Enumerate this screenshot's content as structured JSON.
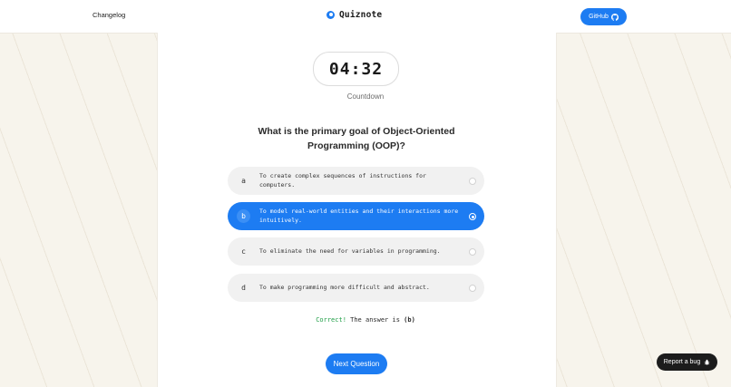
{
  "header": {
    "changelog_label": "Changelog",
    "brand_name": "Quiznote",
    "github_label": "GitHub"
  },
  "timer": {
    "value": "04:32",
    "label": "Countdown"
  },
  "question": {
    "text": "What is the primary goal of Object-Oriented Programming (OOP)?"
  },
  "options": [
    {
      "letter": "a",
      "text": "To create complex sequences of instructions for computers.",
      "selected": false
    },
    {
      "letter": "b",
      "text": "To model real-world entities and their interactions more intuitively.",
      "selected": true
    },
    {
      "letter": "c",
      "text": "To eliminate the need for variables in programming.",
      "selected": false
    },
    {
      "letter": "d",
      "text": "To make programming more difficult and abstract.",
      "selected": false
    }
  ],
  "result": {
    "status": "Correct!",
    "message": "The answer is",
    "answer": "(b)"
  },
  "next_button_label": "Next Question",
  "report_bug_label": "Report a bug",
  "colors": {
    "accent": "#1d7cf2",
    "correct": "#1f9e46",
    "background": "#f7f4ec"
  },
  "icons": {
    "brand": "quiznote-logo-icon",
    "github": "github-icon",
    "bug": "bug-icon"
  }
}
